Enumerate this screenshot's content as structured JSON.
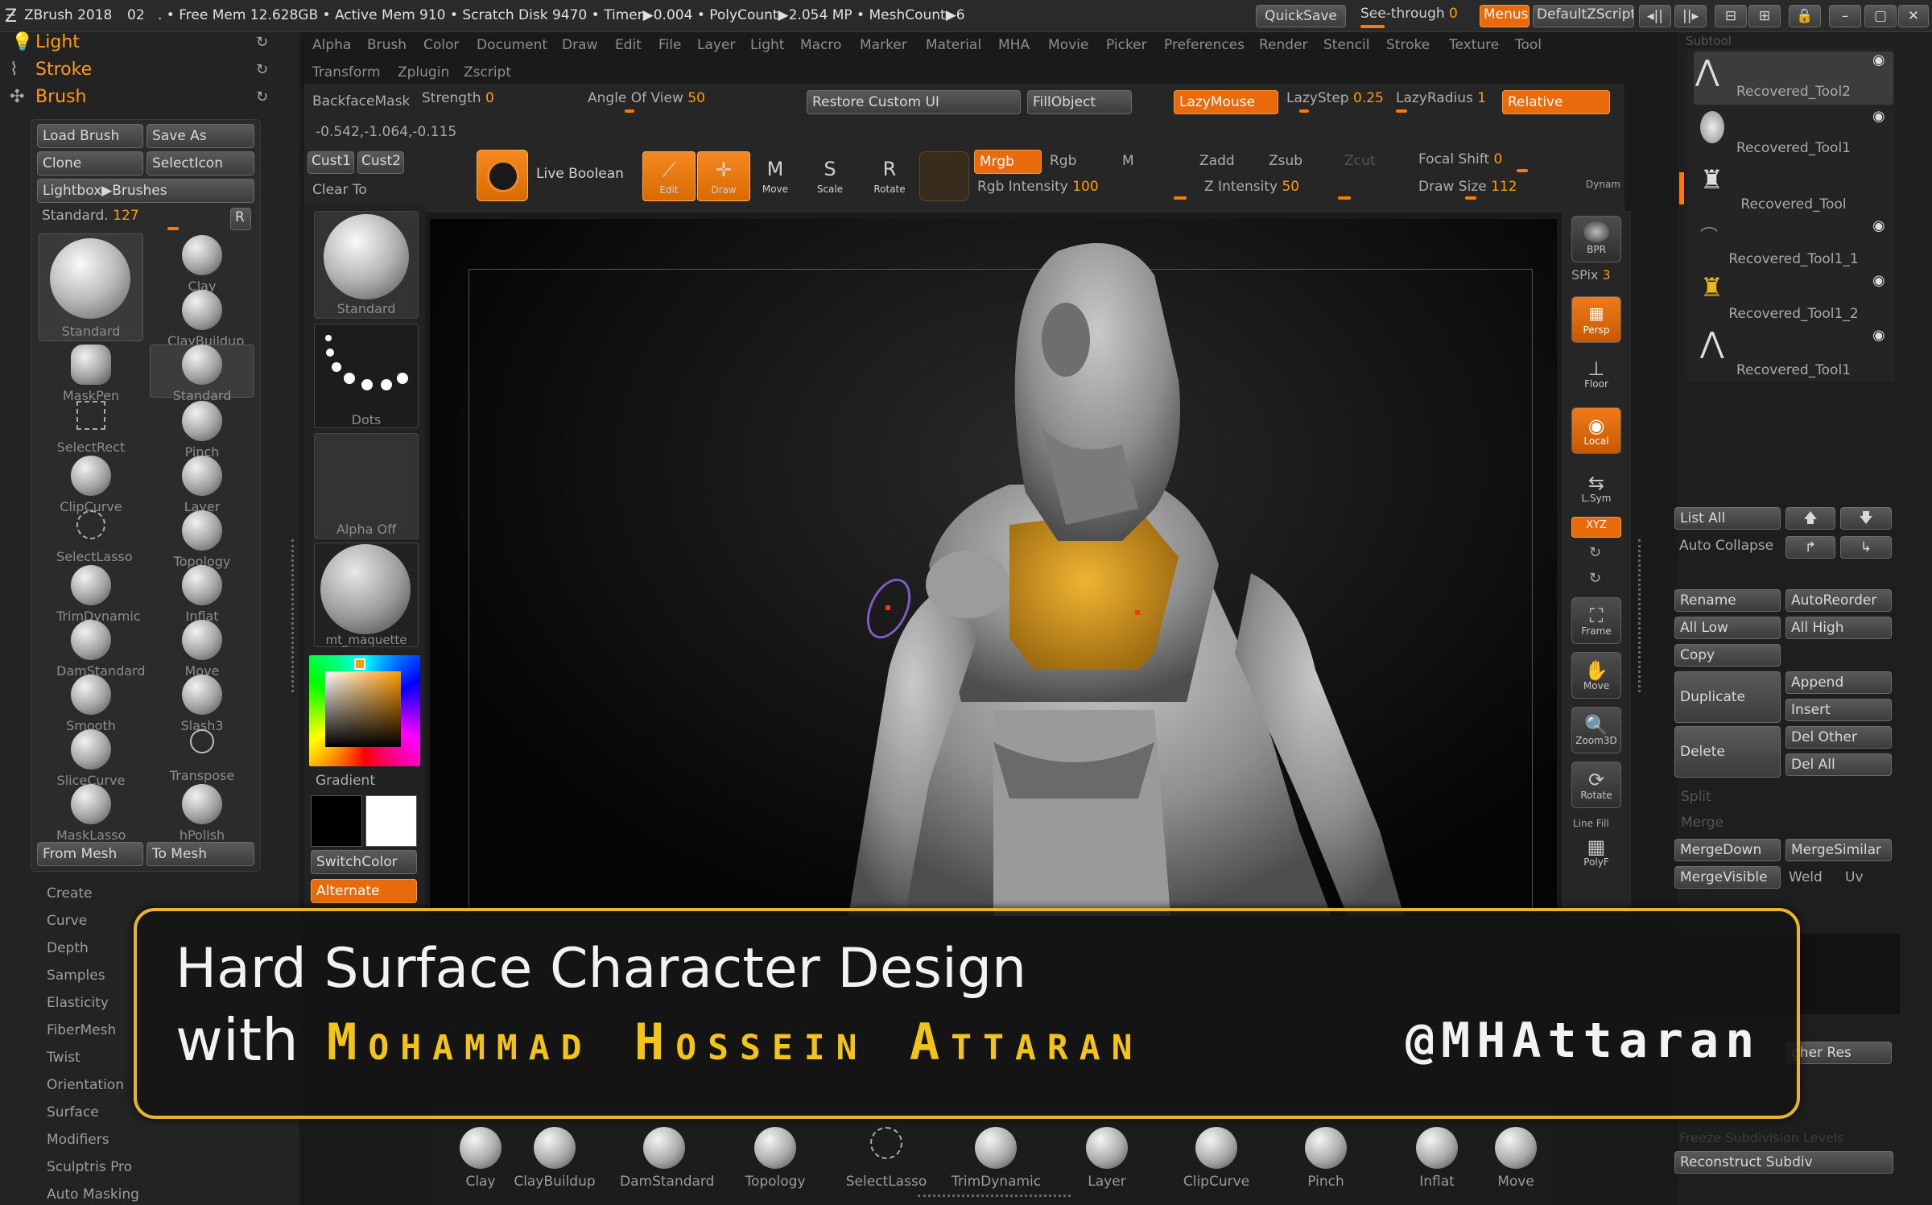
{
  "titlebar": {
    "app": "ZBrush 2018",
    "doc": "02",
    "stats": ". • Free Mem 12.628GB • Active Mem 910 • Scratch Disk 9470 • Timer▶0.004 • PolyCount▶2.054 MP • MeshCount▶6",
    "quicksave": "QuickSave",
    "see_through": "See-through",
    "see_through_value": "0",
    "menus": "Menus",
    "zscript": "DefaultZScript"
  },
  "menu": [
    "Alpha",
    "Brush",
    "Color",
    "Document",
    "Draw",
    "Edit",
    "File",
    "Layer",
    "Light",
    "Macro",
    "Marker",
    "Material",
    "MHA",
    "Movie",
    "Picker",
    "Preferences",
    "Render",
    "Stencil",
    "Stroke",
    "Texture",
    "Tool",
    "Transform",
    "Zplugin",
    "Zscript"
  ],
  "left_tray": {
    "light": "Light",
    "stroke": "Stroke",
    "brush": "Brush"
  },
  "brush_palette": {
    "load": "Load Brush",
    "save_as": "Save As",
    "clone": "Clone",
    "selecticon": "SelectIcon",
    "lightbox": "Lightbox▶Brushes",
    "standard_label": "Standard.",
    "standard_value": "127",
    "r": "R",
    "brushes": [
      "Standard",
      "Clay",
      "ClayBuildup",
      "MaskPen",
      "Standard",
      "SelectRect",
      "Pinch",
      "ClipCurve",
      "Layer",
      "SelectLasso",
      "Topology",
      "TrimDynamic",
      "Inflat",
      "DamStandard",
      "Move",
      "Smooth",
      "Slash3",
      "SliceCurve",
      "Transpose",
      "MaskLasso",
      "hPolish"
    ],
    "from_mesh": "From Mesh",
    "to_mesh": "To Mesh"
  },
  "left_menu": [
    "Create",
    "Curve",
    "Depth",
    "Samples",
    "Elasticity",
    "FiberMesh",
    "Twist",
    "Orientation",
    "Surface",
    "Modifiers",
    "Sculptris Pro",
    "Auto Masking"
  ],
  "toolbar": {
    "backface": "BackfaceMask",
    "strength_label": "Strength",
    "strength_value": "0",
    "angle_label": "Angle Of View",
    "angle_value": "50",
    "restore": "Restore Custom UI",
    "fillobject": "FillObject",
    "lazymouse": "LazyMouse",
    "lazystep_label": "LazyStep",
    "lazystep_value": "0.25",
    "lazyradius_label": "LazyRadius",
    "lazyradius_value": "1",
    "relative": "Relative",
    "coords": "-0.542,-1.064,-0.115",
    "cust1": "Cust1",
    "cust2": "Cust2",
    "clear_to": "Clear To",
    "live_boolean": "Live Boolean",
    "edit": "Edit",
    "draw": "Draw",
    "move": "Move",
    "scale": "Scale",
    "rotate": "Rotate",
    "mrgb": "Mrgb",
    "rgb": "Rgb",
    "m": "M",
    "zadd": "Zadd",
    "zsub": "Zsub",
    "zcut": "Zcut",
    "rgb_int_label": "Rgb Intensity",
    "rgb_int_value": "100",
    "z_int_label": "Z Intensity",
    "z_int_value": "50",
    "focal_label": "Focal Shift",
    "focal_value": "0",
    "draw_label": "Draw Size",
    "draw_value": "112",
    "dynamic": "Dynam"
  },
  "inner_left": {
    "standard": "Standard",
    "dots": "Dots",
    "alpha_off": "Alpha Off",
    "material": "mt_maquette",
    "gradient": "Gradient",
    "switchcolor": "SwitchColor",
    "alternate": "Alternate"
  },
  "right_tools": {
    "bpr": "BPR",
    "spix_label": "SPix",
    "spix_value": "3",
    "persp": "Persp",
    "floor": "Floor",
    "local": "Local",
    "lsym": "L.Sym",
    "xyz": "XYZ",
    "frame": "Frame",
    "move": "Move",
    "zoom3d": "Zoom3D",
    "rotate": "Rotate",
    "linefill": "Line Fill",
    "polyf": "PolyF"
  },
  "subtool": {
    "header": "Subtool",
    "items": [
      "Recovered_Tool2",
      "Recovered_Tool1",
      "Recovered_Tool",
      "Recovered_Tool1_1",
      "Recovered_Tool1_2",
      "Recovered_Tool1"
    ],
    "list_all": "List All",
    "auto_collapse": "Auto Collapse",
    "rename": "Rename",
    "autoreorder": "AutoReorder",
    "all_low": "All Low",
    "all_high": "All High",
    "copy": "Copy",
    "duplicate": "Duplicate",
    "append": "Append",
    "insert": "Insert",
    "delete": "Delete",
    "del_other": "Del Other",
    "del_all": "Del All",
    "split": "Split",
    "merge": "Merge",
    "mergedown": "MergeDown",
    "mergesimilar": "MergeSimilar",
    "mergevisible": "MergeVisible",
    "weld": "Weld",
    "uv": "Uv",
    "higher_res": "gher Res",
    "freeze": "Freeze Subdivision Levels",
    "reconstruct": "Reconstruct Subdiv"
  },
  "shelf": [
    "Clay",
    "ClayBuildup",
    "DamStandard",
    "Topology",
    "SelectLasso",
    "TrimDynamic",
    "Layer",
    "ClipCurve",
    "Pinch",
    "Inflat",
    "Move"
  ],
  "banner": {
    "line1": "Hard Surface Character Design",
    "with": "with",
    "author": "Mohammad Hossein Attaran",
    "handle": "@MHAttaran"
  },
  "colors": {
    "accent": "#e96a0b",
    "banner_border": "#e8b52a",
    "author": "#f3c417"
  }
}
